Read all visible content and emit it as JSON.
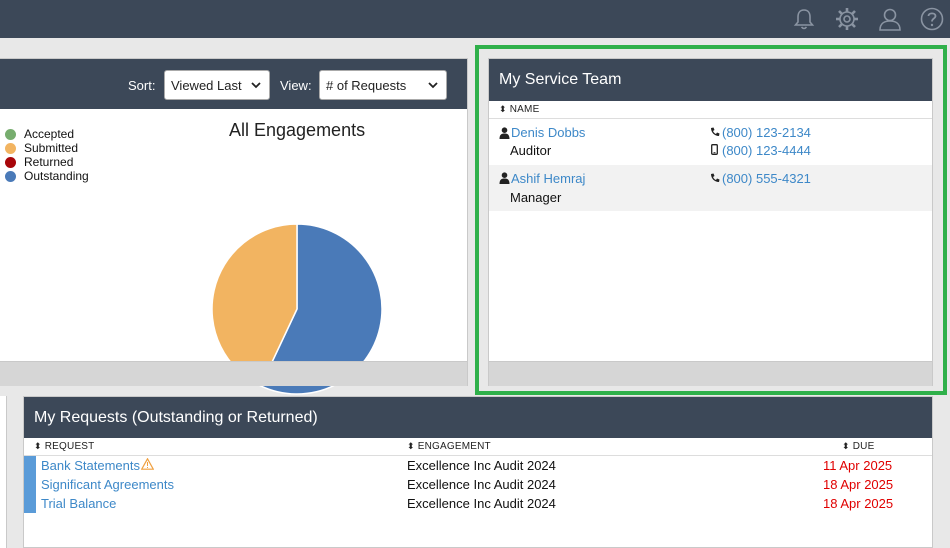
{
  "topbar": {
    "icons": [
      "bell-icon",
      "gear-icon",
      "user-icon",
      "help-icon"
    ]
  },
  "engagements": {
    "sort_label": "Sort:",
    "sort_value": "Viewed Last",
    "view_label": "View:",
    "view_value": "# of Requests",
    "legend": [
      {
        "label": "Accepted",
        "color": "#77ad6e"
      },
      {
        "label": "Submitted",
        "color": "#f2b461"
      },
      {
        "label": "Returned",
        "color": "#a8060a"
      },
      {
        "label": "Outstanding",
        "color": "#4a7ab8"
      }
    ],
    "chart_data": {
      "type": "pie",
      "title": "All Engagements",
      "categories": [
        "Accepted",
        "Submitted",
        "Returned",
        "Outstanding"
      ],
      "values": [
        0,
        43,
        0,
        57
      ],
      "colors": [
        "#77ad6e",
        "#f2b461",
        "#a8060a",
        "#4a7ab8"
      ],
      "legend": "left"
    }
  },
  "service_team": {
    "title": "My Service Team",
    "column_name": "NAME",
    "members": [
      {
        "name": "Denis Dobbs",
        "role": "Auditor",
        "phone": "(800) 123-2134",
        "mobile": "(800) 123-4444"
      },
      {
        "name": "Ashif Hemraj",
        "role": "Manager",
        "phone": "(800) 555-4321",
        "mobile": ""
      }
    ]
  },
  "requests": {
    "title": "My Requests (Outstanding or Returned)",
    "columns": {
      "request": "REQUEST",
      "engagement": "ENGAGEMENT",
      "due": "DUE"
    },
    "rows": [
      {
        "request": "Bank Statements",
        "engagement": "Excellence Inc Audit 2024",
        "due": "11 Apr 2025",
        "warning": true
      },
      {
        "request": "Significant Agreements",
        "engagement": "Excellence Inc Audit 2024",
        "due": "18 Apr 2025",
        "warning": false
      },
      {
        "request": "Trial Balance",
        "engagement": "Excellence Inc Audit 2024",
        "due": "18 Apr 2025",
        "warning": false
      }
    ]
  }
}
